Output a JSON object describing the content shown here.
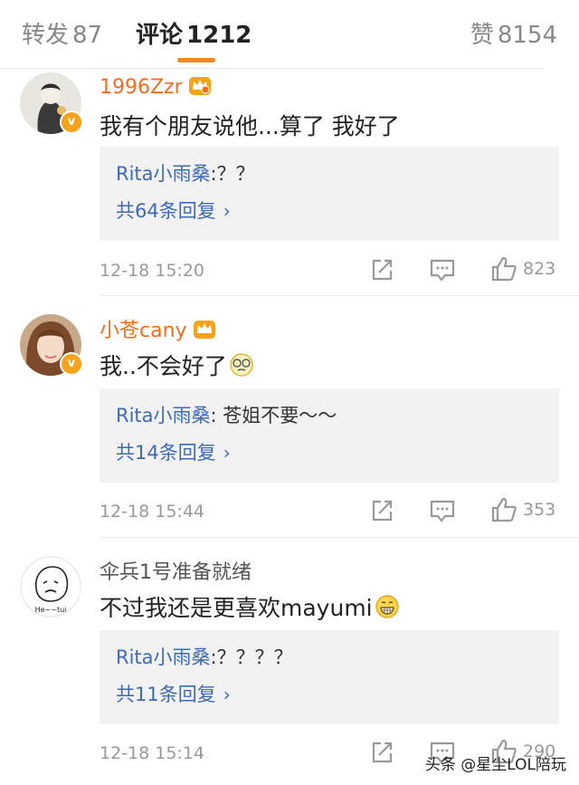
{
  "tabs": {
    "repost": {
      "label": "转发",
      "count": "87"
    },
    "comment": {
      "label": "评论",
      "count": "1212"
    },
    "like": {
      "label": "赞",
      "count": "8154"
    }
  },
  "comments": [
    {
      "username": "1996Zzr",
      "text": "我有个朋友说他...算了 我好了",
      "reply_preview": {
        "name": "Rita小雨桑",
        "text": ":？？"
      },
      "reply_count": "共64条回复",
      "time": "12-18 15:20",
      "likes": "823"
    },
    {
      "username": "小苍cany",
      "text": "我..不会好了",
      "reply_preview": {
        "name": "Rita小雨桑",
        "text": ": 苍姐不要～～"
      },
      "reply_count": "共14条回复",
      "time": "12-18 15:44",
      "likes": "353"
    },
    {
      "username": "伞兵1号准备就绪",
      "text": "不过我还是更喜欢mayumi",
      "reply_preview": {
        "name": "Rita小雨桑",
        "text": ":？？？？"
      },
      "reply_count": "共11条回复",
      "time": "12-18 15:14",
      "likes": "290"
    }
  ],
  "avatar3_caption": "He~~tui",
  "vip_badge": "v",
  "watermark": "头条 @星尘LOL陪玩",
  "colors": {
    "accent": "#f7891e",
    "link": "#3d6bb3",
    "username_vip": "#f36c21"
  }
}
